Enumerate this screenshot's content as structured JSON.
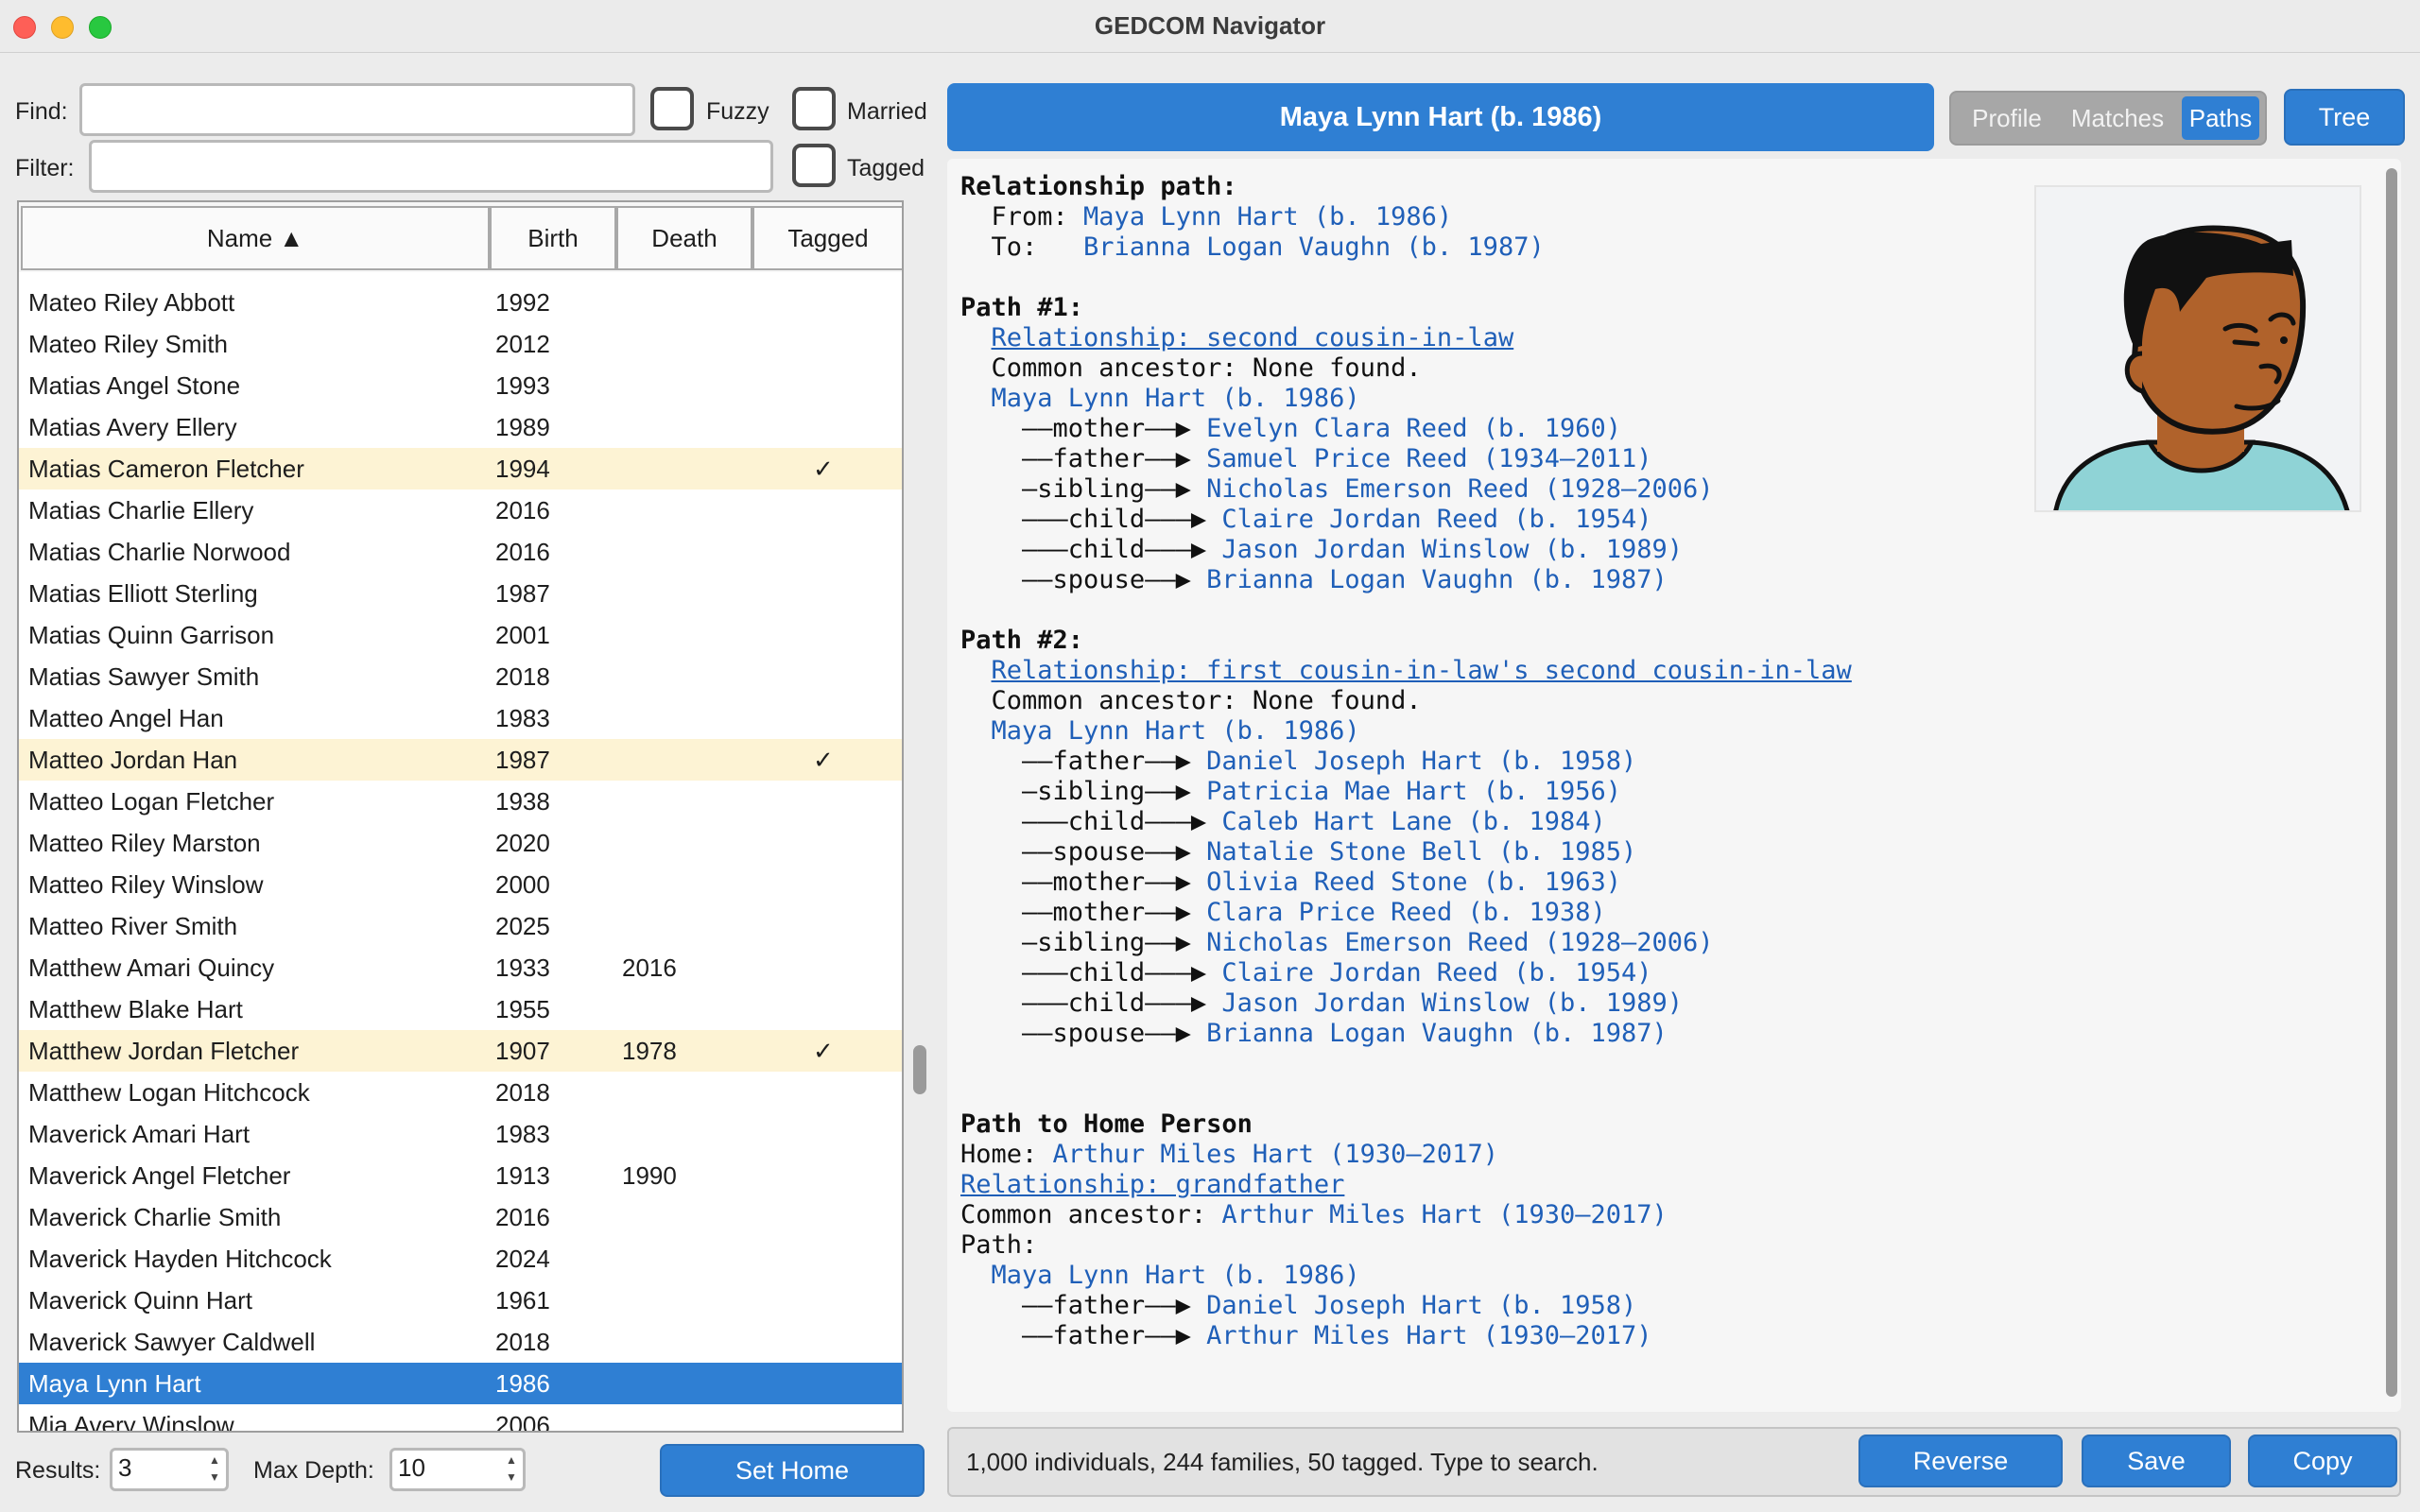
{
  "window": {
    "title": "GEDCOM Navigator"
  },
  "search": {
    "find_label": "Find:",
    "find_value": "",
    "filter_label": "Filter:",
    "filter_value": "",
    "fuzzy_label": "Fuzzy",
    "married_label": "Married",
    "tagged_label": "Tagged"
  },
  "table": {
    "columns": [
      "Name ▲",
      "Birth",
      "Death",
      "Tagged"
    ],
    "rows": [
      {
        "name": "Mateo Riley Abbott",
        "birth": "1992",
        "death": "",
        "tagged": ""
      },
      {
        "name": "Mateo Riley Smith",
        "birth": "2012",
        "death": "",
        "tagged": ""
      },
      {
        "name": "Matias Angel Stone",
        "birth": "1993",
        "death": "",
        "tagged": ""
      },
      {
        "name": "Matias Avery Ellery",
        "birth": "1989",
        "death": "",
        "tagged": ""
      },
      {
        "name": "Matias Cameron Fletcher",
        "birth": "1994",
        "death": "",
        "tagged": "✓"
      },
      {
        "name": "Matias Charlie Ellery",
        "birth": "2016",
        "death": "",
        "tagged": ""
      },
      {
        "name": "Matias Charlie Norwood",
        "birth": "2016",
        "death": "",
        "tagged": ""
      },
      {
        "name": "Matias Elliott Sterling",
        "birth": "1987",
        "death": "",
        "tagged": ""
      },
      {
        "name": "Matias Quinn Garrison",
        "birth": "2001",
        "death": "",
        "tagged": ""
      },
      {
        "name": "Matias Sawyer Smith",
        "birth": "2018",
        "death": "",
        "tagged": ""
      },
      {
        "name": "Matteo Angel Han",
        "birth": "1983",
        "death": "",
        "tagged": ""
      },
      {
        "name": "Matteo Jordan Han",
        "birth": "1987",
        "death": "",
        "tagged": "✓"
      },
      {
        "name": "Matteo Logan Fletcher",
        "birth": "1938",
        "death": "",
        "tagged": ""
      },
      {
        "name": "Matteo Riley Marston",
        "birth": "2020",
        "death": "",
        "tagged": ""
      },
      {
        "name": "Matteo Riley Winslow",
        "birth": "2000",
        "death": "",
        "tagged": ""
      },
      {
        "name": "Matteo River Smith",
        "birth": "2025",
        "death": "",
        "tagged": ""
      },
      {
        "name": "Matthew Amari Quincy",
        "birth": "1933",
        "death": "2016",
        "tagged": ""
      },
      {
        "name": "Matthew Blake Hart",
        "birth": "1955",
        "death": "",
        "tagged": ""
      },
      {
        "name": "Matthew Jordan Fletcher",
        "birth": "1907",
        "death": "1978",
        "tagged": "✓"
      },
      {
        "name": "Matthew Logan Hitchcock",
        "birth": "2018",
        "death": "",
        "tagged": ""
      },
      {
        "name": "Maverick Amari Hart",
        "birth": "1983",
        "death": "",
        "tagged": ""
      },
      {
        "name": "Maverick Angel Fletcher",
        "birth": "1913",
        "death": "1990",
        "tagged": ""
      },
      {
        "name": "Maverick Charlie Smith",
        "birth": "2016",
        "death": "",
        "tagged": ""
      },
      {
        "name": "Maverick Hayden Hitchcock",
        "birth": "2024",
        "death": "",
        "tagged": ""
      },
      {
        "name": "Maverick Quinn Hart",
        "birth": "1961",
        "death": "",
        "tagged": ""
      },
      {
        "name": "Maverick Sawyer Caldwell",
        "birth": "2018",
        "death": "",
        "tagged": ""
      },
      {
        "name": "Maya Lynn Hart",
        "birth": "1986",
        "death": "",
        "tagged": "",
        "selected": true
      },
      {
        "name": "Mia Avery Winslow",
        "birth": "2006",
        "death": "",
        "tagged": ""
      }
    ]
  },
  "bottom_left": {
    "results_label": "Results:",
    "results_value": "3",
    "max_depth_label": "Max Depth:",
    "max_depth_value": "10",
    "set_home_label": "Set Home"
  },
  "header": {
    "person_title": "Maya Lynn Hart (b. 1986)",
    "tabs": [
      {
        "label": "Profile",
        "active": false
      },
      {
        "label": "Matches",
        "active": false
      },
      {
        "label": "Paths",
        "active": true
      }
    ],
    "tree_label": "Tree"
  },
  "paths": {
    "heading": "Relationship path:",
    "from_label": "  From: ",
    "from_person": "Maya Lynn Hart (b. 1986)",
    "to_label": "  To:   ",
    "to_person": "Brianna Logan Vaughn (b. 1987)",
    "path1": {
      "title": "Path #1:",
      "relationship": "Relationship: second cousin-in-law",
      "common_ancestor": "Common ancestor: None found.",
      "start": "Maya Lynn Hart (b. 1986)",
      "steps": [
        {
          "rel": "——mother——▶ ",
          "person": "Evelyn Clara Reed (b. 1960)"
        },
        {
          "rel": "——father——▶ ",
          "person": "Samuel Price Reed (1934–2011)"
        },
        {
          "rel": "—sibling——▶ ",
          "person": "Nicholas Emerson Reed (1928–2006)"
        },
        {
          "rel": "———child———▶ ",
          "person": "Claire Jordan Reed (b. 1954)"
        },
        {
          "rel": "———child———▶ ",
          "person": "Jason Jordan Winslow (b. 1989)"
        },
        {
          "rel": "——spouse——▶ ",
          "person": "Brianna Logan Vaughn (b. 1987)"
        }
      ]
    },
    "path2": {
      "title": "Path #2:",
      "relationship": "Relationship: first cousin-in-law's second cousin-in-law",
      "common_ancestor": "Common ancestor: None found.",
      "start": "Maya Lynn Hart (b. 1986)",
      "steps": [
        {
          "rel": "——father——▶ ",
          "person": "Daniel Joseph Hart (b. 1958)"
        },
        {
          "rel": "—sibling——▶ ",
          "person": "Patricia Mae Hart (b. 1956)"
        },
        {
          "rel": "———child———▶ ",
          "person": "Caleb Hart Lane (b. 1984)"
        },
        {
          "rel": "——spouse——▶ ",
          "person": "Natalie Stone Bell (b. 1985)"
        },
        {
          "rel": "——mother——▶ ",
          "person": "Olivia Reed Stone (b. 1963)"
        },
        {
          "rel": "——mother——▶ ",
          "person": "Clara Price Reed (b. 1938)"
        },
        {
          "rel": "—sibling——▶ ",
          "person": "Nicholas Emerson Reed (1928–2006)"
        },
        {
          "rel": "———child———▶ ",
          "person": "Claire Jordan Reed (b. 1954)"
        },
        {
          "rel": "———child———▶ ",
          "person": "Jason Jordan Winslow (b. 1989)"
        },
        {
          "rel": "——spouse——▶ ",
          "person": "Brianna Logan Vaughn (b. 1987)"
        }
      ]
    },
    "home": {
      "title": "Path to Home Person",
      "home_label": "Home: ",
      "home_person": "Arthur Miles Hart (1930–2017)",
      "relationship": "Relationship: grandfather",
      "common_label": "Common ancestor: ",
      "common_person": "Arthur Miles Hart (1930–2017)",
      "path_label": "Path:",
      "start": "Maya Lynn Hart (b. 1986)",
      "steps": [
        {
          "rel": "——father——▶ ",
          "person": "Daniel Joseph Hart (b. 1958)"
        },
        {
          "rel": "——father——▶ ",
          "person": "Arthur Miles Hart (1930–2017)"
        }
      ]
    }
  },
  "status": {
    "text": "1,000 individuals, 244 families, 50 tagged.  Type to search.",
    "reverse_label": "Reverse",
    "save_label": "Save",
    "copy_label": "Copy"
  },
  "colors": {
    "accent": "#2f7fd3",
    "tagged_row": "#fdf3d4",
    "link": "#1f5fb8"
  },
  "icons": {
    "portrait": "person-avatar-icon",
    "sort": "sort-ascending-icon"
  }
}
